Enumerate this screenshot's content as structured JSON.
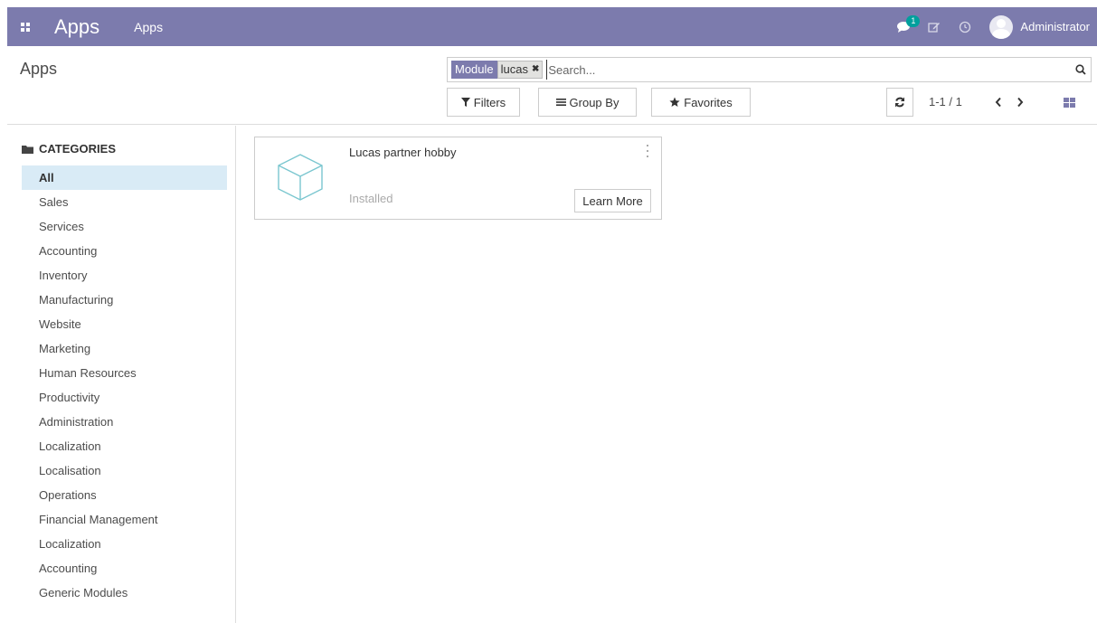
{
  "navbar": {
    "brand": "Apps",
    "menu_item": "Apps",
    "messages_badge": "1",
    "user_name": "Administrator",
    "icons": [
      "apps-grid-icon",
      "chat-icon",
      "edit-icon",
      "clock-icon"
    ]
  },
  "control_panel": {
    "breadcrumb": "Apps",
    "search": {
      "facet_label": "Module",
      "facet_value": "lucas",
      "placeholder": "Search..."
    },
    "filters_label": "Filters",
    "group_by_label": "Group By",
    "favorites_label": "Favorites",
    "pager": "1-1 / 1"
  },
  "sidebar": {
    "header": "CATEGORIES",
    "items": [
      {
        "label": "All",
        "active": true
      },
      {
        "label": "Sales"
      },
      {
        "label": "Services"
      },
      {
        "label": "Accounting"
      },
      {
        "label": "Inventory"
      },
      {
        "label": "Manufacturing"
      },
      {
        "label": "Website"
      },
      {
        "label": "Marketing"
      },
      {
        "label": "Human Resources"
      },
      {
        "label": "Productivity"
      },
      {
        "label": "Administration"
      },
      {
        "label": "Localization"
      },
      {
        "label": "Localisation"
      },
      {
        "label": "Operations"
      },
      {
        "label": "Financial Management"
      },
      {
        "label": "Localization"
      },
      {
        "label": "Accounting"
      },
      {
        "label": "Generic Modules"
      }
    ]
  },
  "apps": [
    {
      "name": "Lucas partner hobby",
      "status": "Installed",
      "action_label": "Learn More"
    }
  ],
  "colors": {
    "navbar": "#7c7bad",
    "active_category": "#d9ebf6",
    "badge": "#00a09d"
  }
}
